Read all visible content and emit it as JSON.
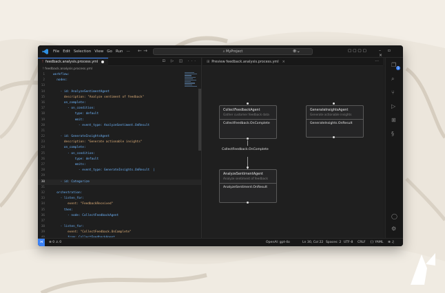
{
  "titlebar": {
    "menu": [
      "File",
      "Edit",
      "Selection",
      "View",
      "Go",
      "Run",
      "···"
    ],
    "nav_arrows": "← →",
    "search_text": "MyProject",
    "copilot_label": "⊕⌄",
    "layout_glyphs": "▢▢▢▢",
    "window_controls": "– ▫ ×"
  },
  "editor": {
    "tab_label": "feedback.analysis.process.yml",
    "tab_actions": "⊡ ▷ ◫ ···",
    "breadcrumb": "! feedback.analysis.process.yml",
    "lines": [
      {
        "n": "1",
        "text": "workflow:",
        "cls": "t-key"
      },
      {
        "n": "2",
        "text": "  nodes:",
        "cls": "t-key"
      },
      {
        "n": "13",
        "text": "",
        "cls": "t-plain"
      },
      {
        "n": "14",
        "text": "    - id: AnalyzeSentimentAgent",
        "cls": "t-key"
      },
      {
        "n": "15",
        "text": "      description: \"Analyze sentiment of feedback\"",
        "cls": "t-str"
      },
      {
        "n": "16",
        "text": "      on_complete:",
        "cls": "t-key"
      },
      {
        "n": "17",
        "text": "        - on_condition:",
        "cls": "t-key"
      },
      {
        "n": "18",
        "text": "            type: default",
        "cls": "t-key"
      },
      {
        "n": "19",
        "text": "            emit:",
        "cls": "t-key"
      },
      {
        "n": "20",
        "text": "              - event_type: AnalyzeSentiment.OnResult",
        "cls": "t-key"
      },
      {
        "n": "21",
        "text": "",
        "cls": "t-plain"
      },
      {
        "n": "22",
        "text": "    - id: GenerateInsightsAgent",
        "cls": "t-key"
      },
      {
        "n": "23",
        "text": "      description: \"Generate actionable insights\"",
        "cls": "t-str"
      },
      {
        "n": "24",
        "text": "      on_complete:",
        "cls": "t-key"
      },
      {
        "n": "25",
        "text": "        - on_condition:",
        "cls": "t-key"
      },
      {
        "n": "26",
        "text": "            type: default",
        "cls": "t-key"
      },
      {
        "n": "27",
        "text": "            emits:",
        "cls": "t-key"
      },
      {
        "n": "28",
        "text": "              - event_type: GenerateInsights.OnResult  |",
        "cls": "t-key"
      },
      {
        "n": "29",
        "text": "",
        "cls": "t-plain"
      },
      {
        "n": "30",
        "text": "    - id: Categorize",
        "cls": "t-key",
        "active": true
      },
      {
        "n": "31",
        "text": "",
        "cls": "t-plain"
      },
      {
        "n": "32",
        "text": "  orchestration:",
        "cls": "t-key"
      },
      {
        "n": "33",
        "text": "    - listen_for:",
        "cls": "t-key"
      },
      {
        "n": "34",
        "text": "        event: \"FeedbackReceived\"",
        "cls": "t-str"
      },
      {
        "n": "35",
        "text": "      then:",
        "cls": "t-key"
      },
      {
        "n": "36",
        "text": "        - node: CollectFeedbackAgent",
        "cls": "t-key"
      },
      {
        "n": "37",
        "text": "",
        "cls": "t-plain"
      },
      {
        "n": "38",
        "text": "    - listen_for:",
        "cls": "t-key"
      },
      {
        "n": "39",
        "text": "        event: \"CollectFeedback.OnComplete\"",
        "cls": "t-str"
      },
      {
        "n": "40",
        "text": "        from: CollectFeedbackAgent",
        "cls": "t-key"
      },
      {
        "n": "41",
        "text": "      then:",
        "cls": "t-key"
      },
      {
        "n": "42",
        "text": "        - node: AnalyzeSentimentAgent",
        "cls": "t-key"
      }
    ]
  },
  "preview": {
    "tab_label": "Preview feedback.analysis.process.yml",
    "tab_close": "×",
    "more": "···",
    "nodes": {
      "collect": {
        "title": "CollectFeedbackAgent",
        "desc": "Gather customer feedback data",
        "emit": "CollectFeedback.OnComplete"
      },
      "generate": {
        "title": "GenerateInsightsAgent",
        "desc": "Generate actionable insights",
        "emit": "GenerateInsights.OnResult"
      },
      "analyze": {
        "title": "AnalyzeSentimentAgent",
        "desc": "Analyze sentiment of feedback",
        "emit": "AnalyzeSentiment.OnResult"
      }
    },
    "event_label": "CollectFeedback.OnComplete"
  },
  "activity": {
    "badge": "1"
  },
  "statusbar": {
    "remote": "⋊",
    "problems": "⊗ 0 ⚠ 0",
    "model": "OpenAI: gpt-4o",
    "cursor": "Ln 30, Col 22",
    "spaces": "Spaces: 2",
    "encoding": "UTF-8",
    "eol": "CRLF",
    "language": "{} YAML",
    "right_icons": "⊕ ♫"
  }
}
